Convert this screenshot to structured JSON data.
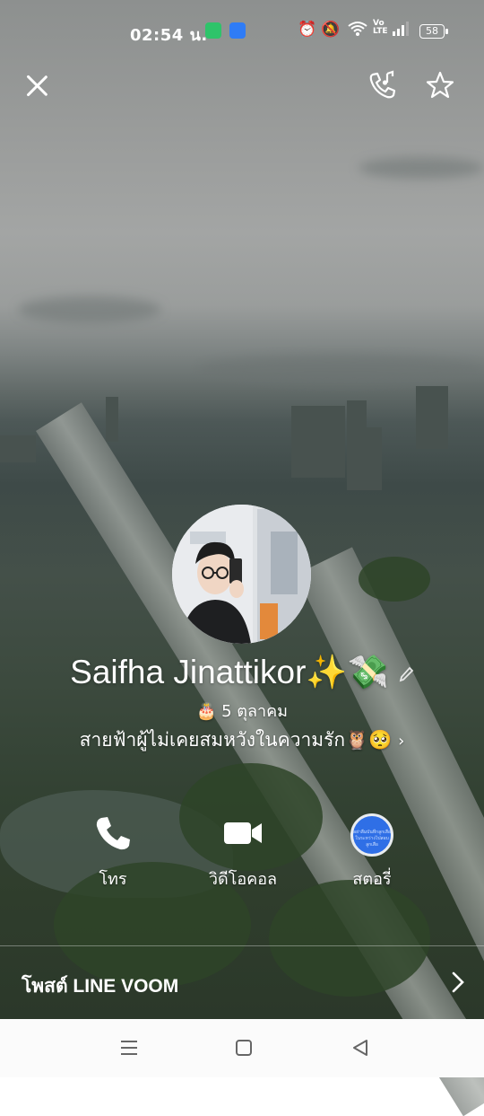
{
  "status_bar": {
    "time": "02:54 น.",
    "volte_label": "Vo LTE",
    "battery_level": "58"
  },
  "header": {
    "close_icon": "close-icon",
    "ringtone_icon": "phone-music-icon",
    "favorite_icon": "star-icon"
  },
  "profile": {
    "name": "Saifha Jinattikor✨💸",
    "birthday": "5 ตุลาคม",
    "status_message": "สายฟ้าผู้ไม่เคยสมหวังในความรัก🦉🥺",
    "edit_icon": "pencil-icon",
    "story_thumb_text": "อย่าลืมบันทึกลูกเสือในระหว่างไปสอบลูกเสือ"
  },
  "actions": [
    {
      "label": "โทร",
      "icon": "phone-icon"
    },
    {
      "label": "วิดีโอคอล",
      "icon": "video-camera-icon"
    },
    {
      "label": "สตอรี่",
      "icon": "story-thumbnail"
    }
  ],
  "voom": {
    "label": "โพสต์ LINE VOOM",
    "icon": "chevron-right-icon"
  },
  "nav": {
    "menu_icon": "recent-apps-icon",
    "home_icon": "home-icon",
    "back_icon": "back-triangle-icon",
    "background": "#fbfbfb"
  }
}
